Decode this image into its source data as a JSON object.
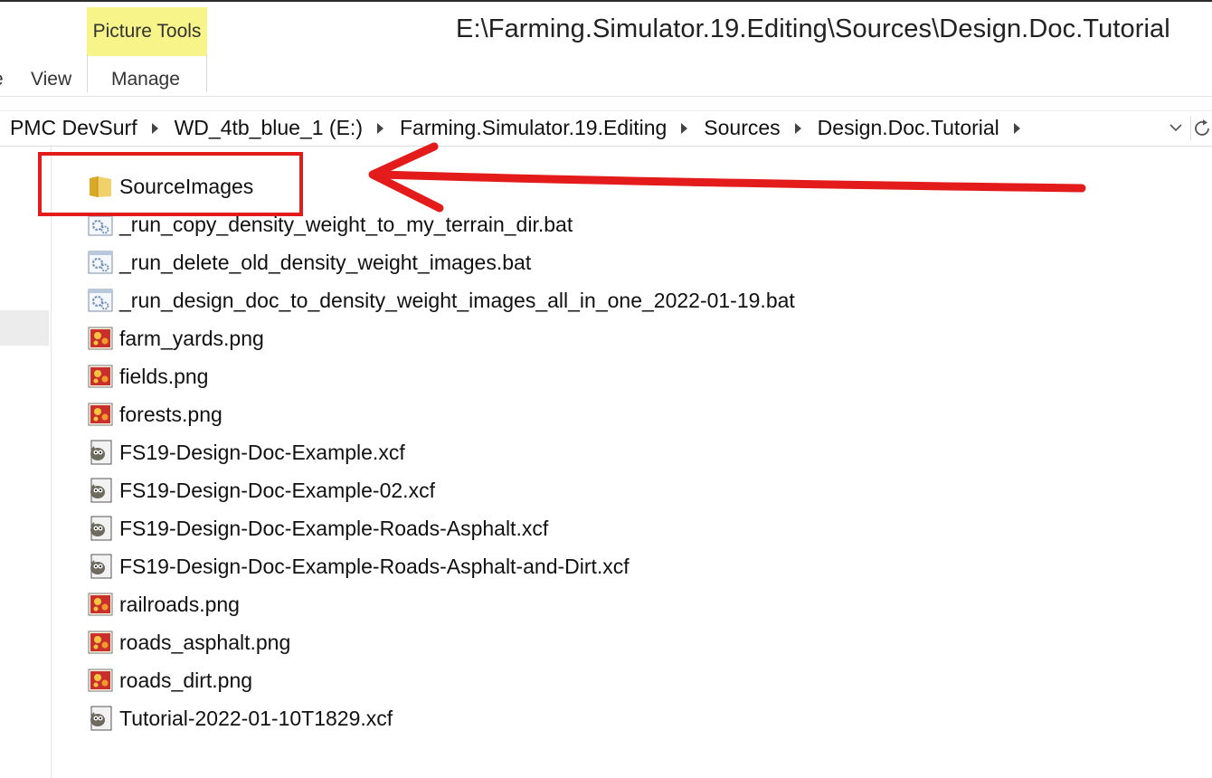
{
  "window": {
    "title": "E:\\Farming.Simulator.19.Editing\\Sources\\Design.Doc.Tutorial",
    "contextual_tab_group": "Picture Tools"
  },
  "ribbon": {
    "tabs": [
      {
        "label": "e"
      },
      {
        "label": "View"
      },
      {
        "label": "Manage"
      }
    ]
  },
  "address_bar": {
    "breadcrumbs": [
      {
        "label": "PMC DevSurf"
      },
      {
        "label": "WD_4tb_blue_1 (E:)"
      },
      {
        "label": "Farming.Simulator.19.Editing"
      },
      {
        "label": "Sources"
      },
      {
        "label": "Design.Doc.Tutorial"
      }
    ]
  },
  "files": [
    {
      "name": "SourceImages",
      "icon": "folder-icon"
    },
    {
      "name": "_run_copy_density_weight_to_my_terrain_dir.bat",
      "icon": "batch-file-icon"
    },
    {
      "name": "_run_delete_old_density_weight_images.bat",
      "icon": "batch-file-icon"
    },
    {
      "name": "_run_design_doc_to_density_weight_images_all_in_one_2022-01-19.bat",
      "icon": "batch-file-icon"
    },
    {
      "name": "farm_yards.png",
      "icon": "png-image-icon"
    },
    {
      "name": "fields.png",
      "icon": "png-image-icon"
    },
    {
      "name": "forests.png",
      "icon": "png-image-icon"
    },
    {
      "name": "FS19-Design-Doc-Example.xcf",
      "icon": "gimp-xcf-icon"
    },
    {
      "name": "FS19-Design-Doc-Example-02.xcf",
      "icon": "gimp-xcf-icon"
    },
    {
      "name": "FS19-Design-Doc-Example-Roads-Asphalt.xcf",
      "icon": "gimp-xcf-icon"
    },
    {
      "name": "FS19-Design-Doc-Example-Roads-Asphalt-and-Dirt.xcf",
      "icon": "gimp-xcf-icon"
    },
    {
      "name": "railroads.png",
      "icon": "png-image-icon"
    },
    {
      "name": "roads_asphalt.png",
      "icon": "png-image-icon"
    },
    {
      "name": "roads_dirt.png",
      "icon": "png-image-icon"
    },
    {
      "name": "Tutorial-2022-01-10T1829.xcf",
      "icon": "gimp-xcf-icon"
    }
  ],
  "colors": {
    "annotation": "#e41b1b",
    "contextual_tab": "#f7f58a"
  }
}
